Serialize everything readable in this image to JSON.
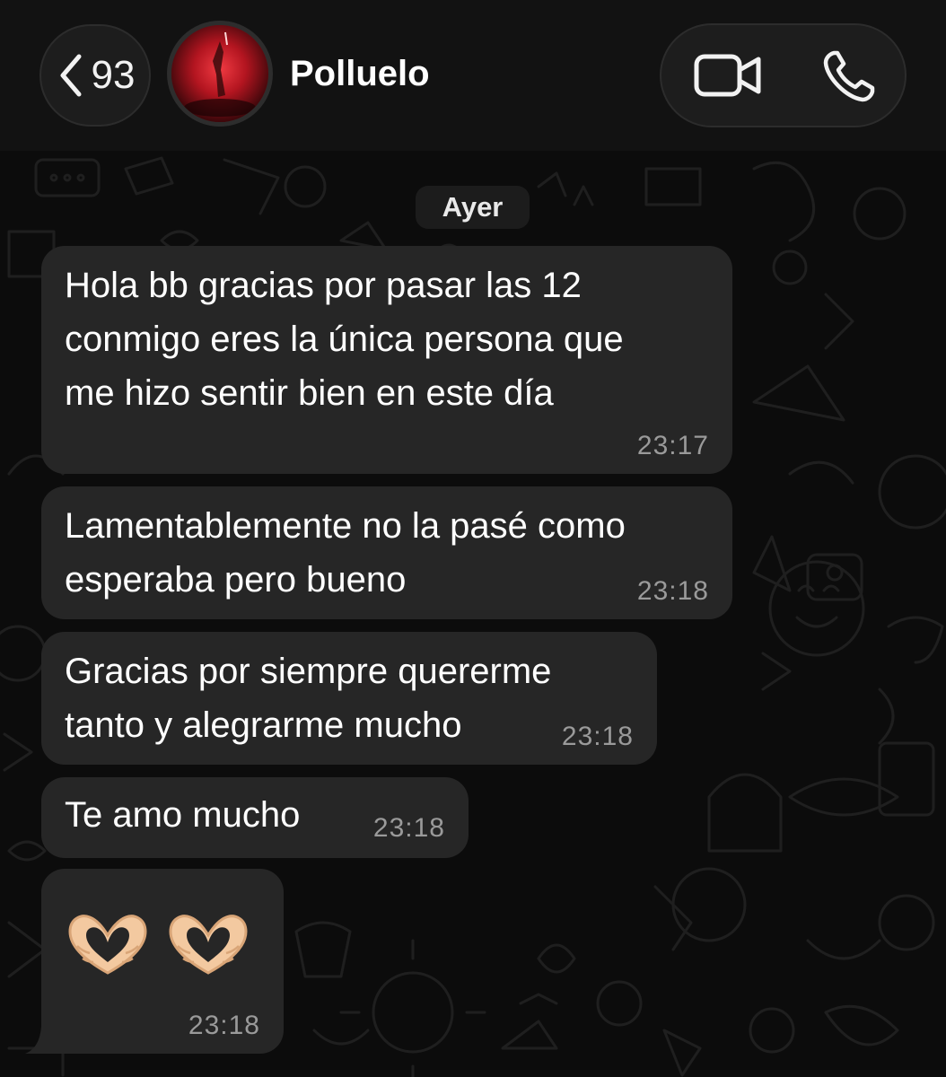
{
  "header": {
    "back_count": "93",
    "contact_name": "Polluelo"
  },
  "chat": {
    "date_label": "Ayer",
    "messages": [
      {
        "text": "Hola bb gracias por pasar las 12\nconmigo eres la única persona que\nme hizo sentir bien en este día",
        "time": "23:17"
      },
      {
        "text": "Lamentablemente no la pasé como\nesperaba pero bueno",
        "time": "23:18"
      },
      {
        "text": "Gracias por siempre quererme\ntanto y alegrarme mucho",
        "time": "23:18"
      },
      {
        "text": "Te amo mucho",
        "time": "23:18"
      },
      {
        "text": "🫶🫶",
        "time": "23:18"
      }
    ]
  },
  "colors": {
    "background": "#0b0b0b",
    "bubble": "#262626",
    "header": "#121212",
    "timestamp": "#9a9a9a"
  }
}
